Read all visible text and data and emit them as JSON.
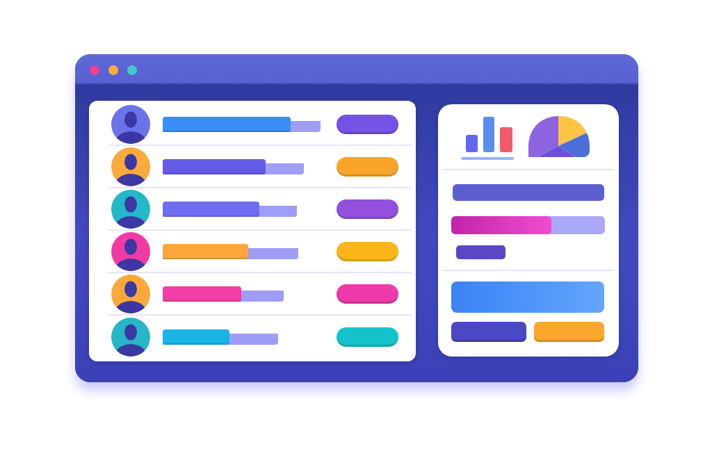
{
  "window": {
    "controls": [
      {
        "color": "#f2418f"
      },
      {
        "color": "#fdae3b"
      },
      {
        "color": "#3dcdc9"
      }
    ]
  },
  "user_list": {
    "rows": [
      {
        "avatar": {
          "color": "#6b73ea"
        },
        "progress": {
          "level": 0.81,
          "color": "#3a8ef5"
        },
        "tag": {
          "color": "#7452e6"
        }
      },
      {
        "avatar": {
          "color": "#fbaa3c"
        },
        "progress": {
          "level": 0.73,
          "color": "#645ce6"
        },
        "tag": {
          "color": "#fba42a"
        }
      },
      {
        "avatar": {
          "color": "#22b8c8"
        },
        "progress": {
          "level": 0.72,
          "color": "#6d6ef0"
        },
        "tag": {
          "color": "#9150de"
        }
      },
      {
        "avatar": {
          "color": "#f23aa5"
        },
        "progress": {
          "level": 0.63,
          "color": "#fba73a"
        },
        "tag": {
          "color": "#fdb61a"
        }
      },
      {
        "avatar": {
          "color": "#fba83a"
        },
        "progress": {
          "level": 0.65,
          "color": "#f23ea6"
        },
        "tag": {
          "color": "#ec3aa8"
        }
      },
      {
        "avatar": {
          "color": "#26b6c6"
        },
        "progress": {
          "level": 0.58,
          "color": "#18b4e6"
        },
        "tag": {
          "color": "#14c2cc"
        }
      }
    ]
  },
  "side_panel": {
    "progress": {
      "level": 0.65
    },
    "buttons": [
      {
        "color": "#4a48c4"
      },
      {
        "color": "#fba62c"
      }
    ]
  }
}
